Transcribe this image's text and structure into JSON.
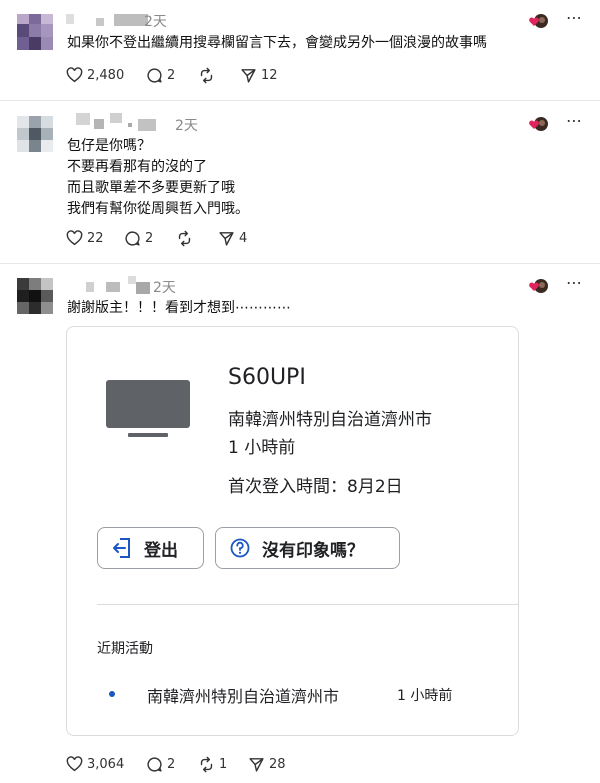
{
  "posts": [
    {
      "time": "2天",
      "text": "如果你不登出繼續用搜尋欄留言下去，會變成另外一個浪漫的故事嗎",
      "likes": "2,480",
      "comments": "2",
      "reposts": "",
      "shares": "12"
    },
    {
      "time": "2天",
      "text": "包仔是你嗎？\n不要再看那有的沒的了\n而且歌單差不多要更新了哦\n我們有幫你從周興哲入門哦。",
      "likes": "22",
      "comments": "2",
      "reposts": "",
      "shares": "4"
    },
    {
      "time": "2天",
      "text": "謝謝版主！！！看到才想到⋯⋯⋯⋯",
      "likes": "3,064",
      "comments": "2",
      "reposts": "1",
      "shares": "28"
    }
  ],
  "device_card": {
    "device_name": "S60UPI",
    "location": "南韓濟州特別自治道濟州市",
    "time_ago": "1 小時前",
    "first_login": "首次登入時間：8月2日",
    "logout_label": "登出",
    "unfamiliar_label": "沒有印象嗎？",
    "recent_title": "近期活動",
    "recent_location": "南韓濟州特別自治道濟州市",
    "recent_time": "1 小時前"
  },
  "icons": {
    "like": "heart-icon",
    "comment": "comment-bubble-icon",
    "repost": "repost-icon",
    "share": "send-icon",
    "more": "more-icon",
    "reaction": "heart-avatar-icon"
  },
  "colors": {
    "accent_red": "#e0245e",
    "dot_blue": "#1a56c4",
    "muted": "#8a8a8a"
  }
}
